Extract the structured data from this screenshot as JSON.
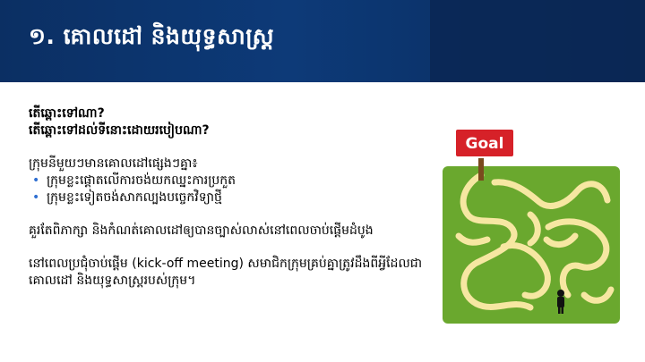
{
  "slide": {
    "title": "១. គោលដៅ និងយុទ្ធសាស្ត្រ",
    "questions": [
      "តើឆ្ពោះទៅណា?",
      "តើឆ្ពោះទៅដល់ទីនោះដោយរបៀបណា?"
    ],
    "intro": "ក្រុមនីមួយៗមានគោលដៅផ្សេងៗគ្នា៖",
    "bullets": [
      "ក្រុមខ្លះផ្តោតលើការចង់យកឈ្នះការប្រកួត",
      "ក្រុមខ្លះទៀតចង់សាកល្បងបច្ចេកវិទ្យាថ្មី"
    ],
    "paragraph1": "គួរតែពិភាក្សា និងកំណត់គោលដៅឲ្យបានច្បាស់លាស់នៅពេលចាប់ផ្តើមដំបូង",
    "paragraph2": "នៅពេលប្រជុំចាប់ផ្តើម (kick-off meeting) សមាជិកក្រុមគ្រប់គ្នាត្រូវដឹងពីអ្វីដែលជាគោលដៅ និងយុទ្ធសាស្ត្ររបស់ក្រុម។"
  },
  "illustration": {
    "sign_text": "Goal",
    "icon": "maze-goal-illustration"
  },
  "colors": {
    "header": "#0d3a78",
    "bullet": "#2f6fd1",
    "grass": "#6aa82e",
    "path": "#f6e7a2",
    "sign": "#d62128"
  }
}
